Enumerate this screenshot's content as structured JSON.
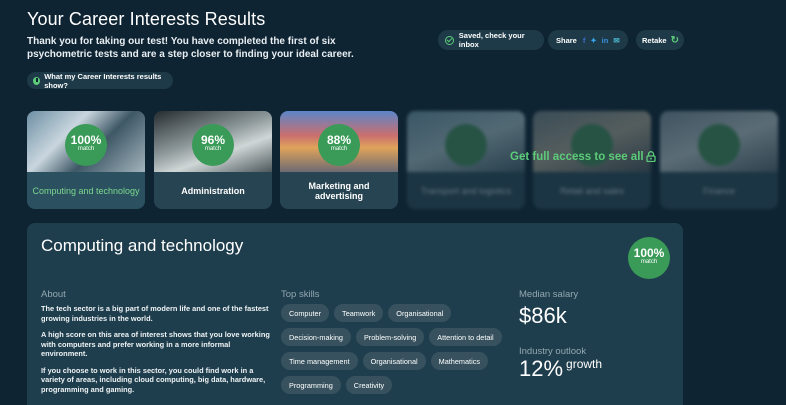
{
  "header": {
    "title": "Your Career Interests Results",
    "intro": "Thank you for taking our test! You have completed the first of six psychometric tests and are a step closer to finding your ideal career.",
    "saved_label": "Saved, check your inbox",
    "share_label": "Share",
    "retake_label": "Retake",
    "results_info_label": "What my Career Interests results show?",
    "share_icons": [
      "facebook-icon",
      "twitter-icon",
      "linkedin-icon",
      "email-icon"
    ]
  },
  "cards": [
    {
      "percent": "100%",
      "sub": "match",
      "label": "Computing and technology"
    },
    {
      "percent": "96%",
      "sub": "match",
      "label": "Administration"
    },
    {
      "percent": "88%",
      "sub": "match",
      "label": "Marketing and advertising"
    },
    {
      "percent": "",
      "sub": "",
      "label": "Transport and logistics"
    },
    {
      "percent": "",
      "sub": "",
      "label": "Retail and sales"
    },
    {
      "percent": "",
      "sub": "",
      "label": "Finance"
    }
  ],
  "unlock_label": "Get full access to see all",
  "detail": {
    "title": "Computing and technology",
    "badge_percent": "100%",
    "badge_sub": "match",
    "about_heading": "About",
    "about_paragraphs": [
      "The tech sector is a big part of modern life and one of the fastest growing industries in the world.",
      "A high score on this area of interest shows that you love working with computers and prefer working in a more informal environment.",
      "If you choose to work in this sector, you could find work in a variety of areas, including cloud computing, big data, hardware, programming and gaming."
    ],
    "skills_heading": "Top skills",
    "skills": [
      "Computer",
      "Teamwork",
      "Organisational",
      "Decision-making",
      "Problem-solving",
      "Attention to detail",
      "Time management",
      "Organisational",
      "Mathematics",
      "Programming",
      "Creativity"
    ],
    "salary_heading": "Median salary",
    "salary_value": "$86k",
    "outlook_heading": "Industry outlook",
    "outlook_value": "12%",
    "outlook_word": "growth"
  },
  "colors": {
    "background": "#0f2433",
    "accent_green": "#5ccc79",
    "badge_green": "#3a9a57",
    "panel": "#1f3e4d"
  }
}
